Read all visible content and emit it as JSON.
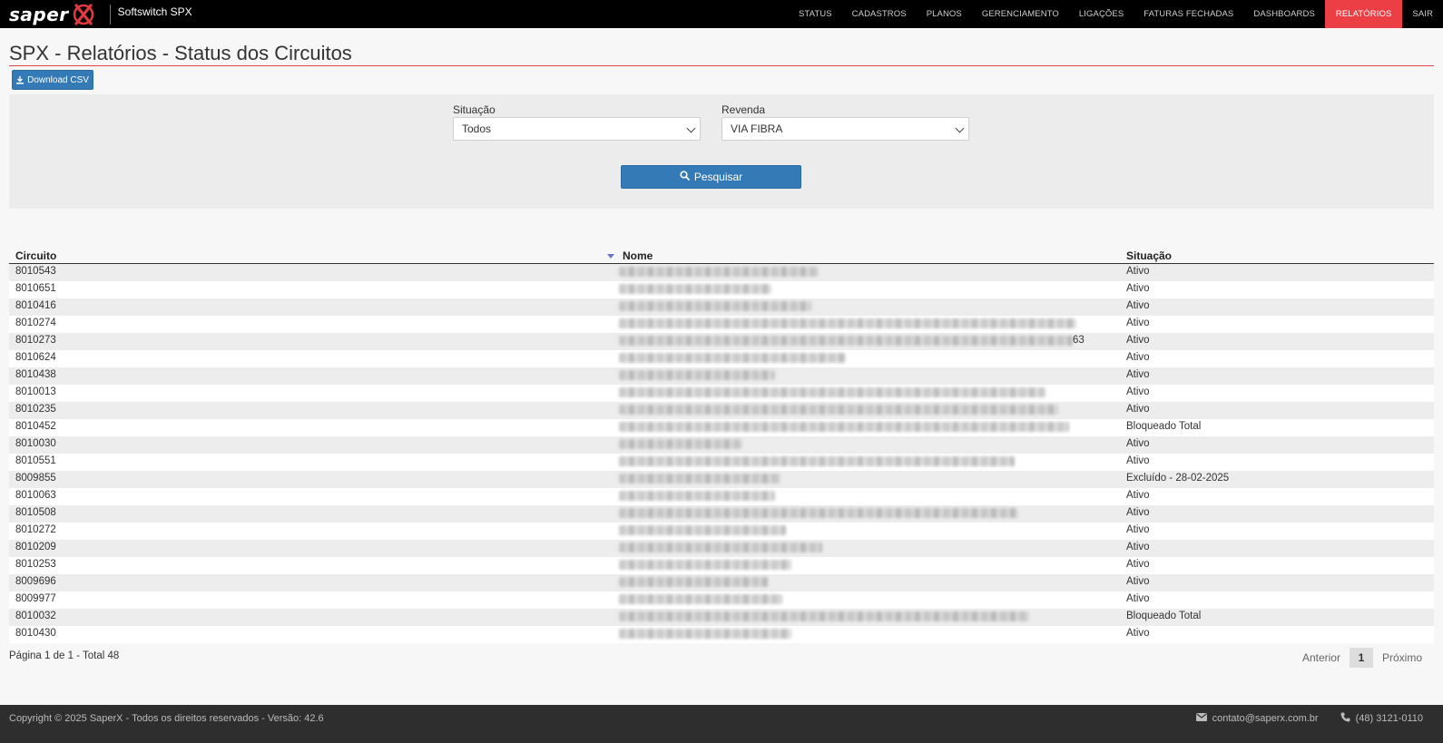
{
  "brand": {
    "logo_text": "saper",
    "app_title": "Softswitch SPX"
  },
  "nav": [
    {
      "label": "STATUS"
    },
    {
      "label": "CADASTROS"
    },
    {
      "label": "PLANOS"
    },
    {
      "label": "GERENCIAMENTO"
    },
    {
      "label": "LIGAÇÕES"
    },
    {
      "label": "FATURAS FECHADAS"
    },
    {
      "label": "DASHBOARDS"
    },
    {
      "label": "RELATÓRIOS",
      "active": true
    },
    {
      "label": "SAIR"
    }
  ],
  "page": {
    "title": "SPX - Relatórios - Status dos Circuitos"
  },
  "actions": {
    "download_csv": "Download CSV"
  },
  "filters": {
    "situacao": {
      "label": "Situação",
      "value": "Todos"
    },
    "revenda": {
      "label": "Revenda",
      "value": "VIA FIBRA"
    },
    "search_button": "Pesquisar"
  },
  "table": {
    "headers": {
      "circuito": "Circuito",
      "nome": "Nome",
      "situacao": "Situação"
    },
    "rows": [
      {
        "circuito": "8010543",
        "situacao": "Ativo"
      },
      {
        "circuito": "8010651",
        "situacao": "Ativo"
      },
      {
        "circuito": "8010416",
        "situacao": "Ativo"
      },
      {
        "circuito": "8010274",
        "situacao": "Ativo"
      },
      {
        "circuito": "8010273",
        "situacao": "Ativo",
        "name_suffix": "63"
      },
      {
        "circuito": "8010624",
        "situacao": "Ativo"
      },
      {
        "circuito": "8010438",
        "situacao": "Ativo"
      },
      {
        "circuito": "8010013",
        "situacao": "Ativo"
      },
      {
        "circuito": "8010235",
        "situacao": "Ativo"
      },
      {
        "circuito": "8010452",
        "situacao": "Bloqueado Total"
      },
      {
        "circuito": "8010030",
        "situacao": "Ativo"
      },
      {
        "circuito": "8010551",
        "situacao": "Ativo"
      },
      {
        "circuito": "8009855",
        "situacao": "Excluído - 28-02-2025"
      },
      {
        "circuito": "8010063",
        "situacao": "Ativo"
      },
      {
        "circuito": "8010508",
        "situacao": "Ativo"
      },
      {
        "circuito": "8010272",
        "situacao": "Ativo"
      },
      {
        "circuito": "8010209",
        "situacao": "Ativo"
      },
      {
        "circuito": "8010253",
        "situacao": "Ativo"
      },
      {
        "circuito": "8009696",
        "situacao": "Ativo"
      },
      {
        "circuito": "8009977",
        "situacao": "Ativo"
      },
      {
        "circuito": "8010032",
        "situacao": "Bloqueado Total"
      },
      {
        "circuito": "8010430",
        "situacao": "Ativo"
      }
    ]
  },
  "pagination": {
    "info": "Página 1 de 1 - Total 48",
    "prev": "Anterior",
    "current": "1",
    "next": "Próximo"
  },
  "footer": {
    "copyright": "Copyright © 2025 SaperX - Todos os direitos reservados - Versão: 42.6",
    "email": "contato@saperx.com.br",
    "phone": "(48) 3121-0110"
  },
  "colors": {
    "accent_red": "#ec3f45",
    "primary_blue": "#337ab7",
    "navbar_bg": "#000000",
    "footer_bg": "#2e2e2e"
  },
  "icons": [
    "download-icon",
    "search-icon",
    "envelope-icon",
    "phone-icon",
    "sort-desc-icon"
  ]
}
